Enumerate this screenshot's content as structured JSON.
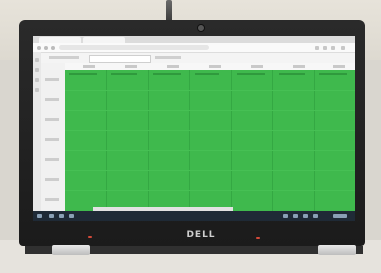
{
  "photo": {
    "subject": "laptop-displaying-calendar",
    "colors": {
      "background": "#d9d6cf",
      "laptop_bezel": "#1b1b1b",
      "screen_chrome": "#f2f2f2",
      "calendar_fill": "#3fb94d",
      "taskbar": "#1f2a36"
    }
  },
  "laptop": {
    "brand": "DELL"
  },
  "screen": {
    "calendar": {
      "day_columns": 7
    }
  },
  "icons": [
    "webcam-icon",
    "browser-tab-icon",
    "calendar-grid-icon",
    "taskbar-icon"
  ]
}
